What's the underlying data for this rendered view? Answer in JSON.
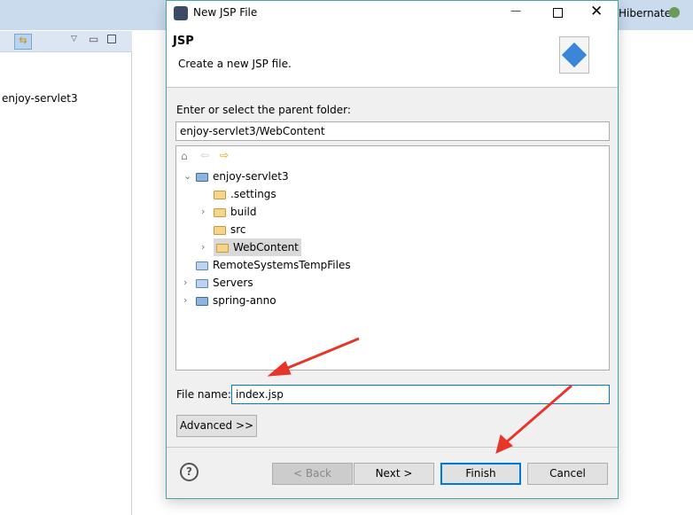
{
  "background": {
    "left_item": "enjoy-servlet3",
    "perspective_label": "Hibernate"
  },
  "dialog": {
    "title": "New JSP File",
    "header_title": "JSP",
    "header_desc": "Create a new JSP file.",
    "folder_label": "Enter or select the parent folder:",
    "folder_value": "enjoy-servlet3/WebContent",
    "tree": [
      {
        "label": "enjoy-servlet3",
        "depth": 0,
        "expander": "expanded",
        "icon": "project-icon"
      },
      {
        "label": ".settings",
        "depth": 1,
        "expander": "none",
        "icon": "folder-icon"
      },
      {
        "label": "build",
        "depth": 1,
        "expander": "collapsed",
        "icon": "folder-icon"
      },
      {
        "label": "src",
        "depth": 1,
        "expander": "none",
        "icon": "folder-icon"
      },
      {
        "label": "WebContent",
        "depth": 1,
        "expander": "collapsed",
        "icon": "folder-icon",
        "selected": true
      },
      {
        "label": "RemoteSystemsTempFiles",
        "depth": 0,
        "expander": "none",
        "icon": "folder-blue-icon"
      },
      {
        "label": "Servers",
        "depth": 0,
        "expander": "collapsed",
        "icon": "folder-blue-icon"
      },
      {
        "label": "spring-anno",
        "depth": 0,
        "expander": "collapsed",
        "icon": "project-icon"
      }
    ],
    "file_name_label": "File name:",
    "file_name_value": "index.jsp",
    "advanced_label": "Advanced >>",
    "back_label": "< Back",
    "next_label": "Next >",
    "finish_label": "Finish",
    "cancel_label": "Cancel"
  },
  "colors": {
    "annotation_arrow": "#e8352a",
    "focus": "#0078d7"
  }
}
